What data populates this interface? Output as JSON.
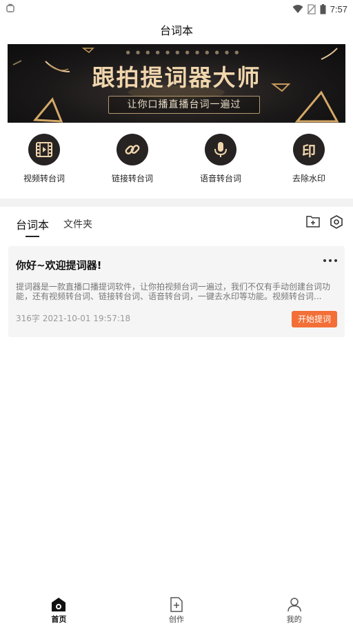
{
  "status_bar": {
    "time": "7:57",
    "icons": [
      "notification-icon",
      "wifi-icon",
      "no-sim-icon",
      "battery-icon"
    ]
  },
  "header": {
    "title": "台词本"
  },
  "banner": {
    "headline": "跟拍提词器大师",
    "subline": "让你口播直播台词一遍过"
  },
  "features": [
    {
      "label": "视频转台词",
      "icon": "film-icon"
    },
    {
      "label": "链接转台词",
      "icon": "link-icon"
    },
    {
      "label": "语音转台词",
      "icon": "microphone-icon"
    },
    {
      "label": "去除水印",
      "icon": "seal-icon",
      "glyph": "印"
    }
  ],
  "tabs": {
    "active": "台词本",
    "folder": "文件夹"
  },
  "script_card": {
    "title": "你好~欢迎提词器!",
    "body": "提词器是一款直播口播提词软件，让你拍视频台词一遍过，我们不仅有手动创建台词功能，还有视频转台词、链接转台词、语音转台词，一键去水印等功能。视频转台词...",
    "meta": "316字 2021-10-01 19:57:18",
    "start_button": "开始提词"
  },
  "bottom_nav": [
    {
      "label": "首页",
      "icon": "home-icon",
      "active": true
    },
    {
      "label": "创作",
      "icon": "add-document-icon",
      "active": false
    },
    {
      "label": "我的",
      "icon": "profile-icon",
      "active": false
    }
  ],
  "colors": {
    "accent": "#f36f37",
    "banner_gold": "#f1d6ad",
    "feature_circle": "#262322"
  }
}
